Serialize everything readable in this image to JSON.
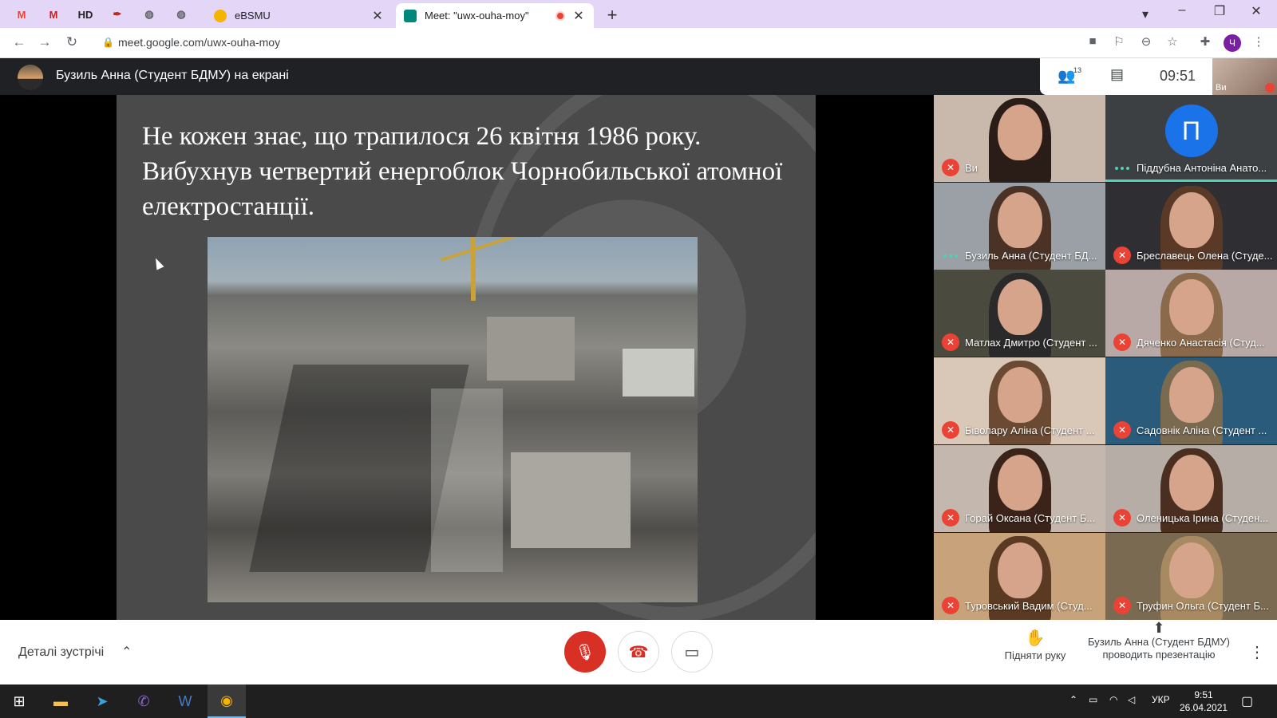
{
  "browser": {
    "pinned_tabs": [
      {
        "icon": "gmail-icon",
        "glyph": "M",
        "color": "#ea4335"
      },
      {
        "icon": "gmail-icon",
        "glyph": "M",
        "color": "#c5221f"
      },
      {
        "icon": "hd-icon",
        "glyph": "HD",
        "color": "#202124"
      },
      {
        "icon": "pen-icon",
        "glyph": "✒",
        "color": "#b3261e"
      },
      {
        "icon": "globe-icon",
        "glyph": "◍",
        "color": "#5f6368"
      },
      {
        "icon": "globe-icon",
        "glyph": "◍",
        "color": "#5f6368"
      }
    ],
    "tabs": [
      {
        "title": "eBSMU",
        "favicon_color": "#f4b400",
        "active": false
      },
      {
        "title": "Meet: \"uwx-ouha-moy\"",
        "favicon_color": "#00897b",
        "active": true,
        "recording_color": "#ea4335"
      }
    ],
    "new_tab_glyph": "+",
    "url": "meet.google.com/uwx-ouha-moy",
    "profile_initial": "Ч"
  },
  "meet": {
    "presenter_banner": "Бузиль Анна (Студент БДМУ) на екрані",
    "participant_count": "13",
    "clock": "09:51",
    "self_label": "Ви",
    "slide": {
      "text": "Не кожен знає, що трапилося 26 квітня 1986 року. Вибухнув четвертий енергоблок Чорнобильської атомної електростанції."
    },
    "participants": [
      {
        "name": "Ви",
        "muted": true,
        "kind": "video",
        "bg": "#c9b9ad",
        "hair": "#2a1d18"
      },
      {
        "name": "Піддубна Антоніна Анато...",
        "muted": false,
        "kind": "avatar",
        "letter": "П",
        "bg": "#3c4043"
      },
      {
        "name": "Бузиль Анна (Студент БД...",
        "muted": false,
        "kind": "video",
        "bg": "#9aa0a6",
        "hair": "#4a3326"
      },
      {
        "name": "Бреславець Олена (Студе...",
        "muted": true,
        "kind": "video",
        "bg": "#2f2f33",
        "hair": "#5a3a26"
      },
      {
        "name": "Матлах Дмитро (Студент ...",
        "muted": true,
        "kind": "video",
        "bg": "#4b4a3e",
        "hair": "#2a2a2a"
      },
      {
        "name": "Дяченко Анастасія (Студ...",
        "muted": true,
        "kind": "video",
        "bg": "#b9a9a6",
        "hair": "#8a6a4a"
      },
      {
        "name": "Біволару Аліна (Студент ...",
        "muted": true,
        "kind": "video",
        "bg": "#d9c7b8",
        "hair": "#6a4a32"
      },
      {
        "name": "Садовнік Аліна (Студент ...",
        "muted": true,
        "kind": "video",
        "bg": "#2b5b7a",
        "hair": "#7a6a50"
      },
      {
        "name": "Горай Оксана (Студент Б...",
        "muted": true,
        "kind": "video",
        "bg": "#c4b8ae",
        "hair": "#3a241a"
      },
      {
        "name": "Оленицька Ірина (Студен...",
        "muted": true,
        "kind": "video",
        "bg": "#b6ada6",
        "hair": "#4a2e20"
      },
      {
        "name": "Туровський Вадим (Студ...",
        "muted": true,
        "kind": "video",
        "bg": "#c7a27a",
        "hair": "#5a3a22"
      },
      {
        "name": "Труфин Ольга (Студент Б...",
        "muted": true,
        "kind": "video",
        "bg": "#7a6a52",
        "hair": "#a88a62"
      }
    ]
  },
  "controls": {
    "details_label": "Деталі зустрічі",
    "raise_hand_label": "Підняти руку",
    "presenting_label": "Бузиль Анна (Студент БДМУ) проводить презентацію"
  },
  "taskbar": {
    "language": "УКР",
    "time": "9:51",
    "date": "26.04.2021"
  },
  "colors": {
    "accent_meet": "#d93025",
    "speaking": "#4fd1b4",
    "tabstrip": "#e3d6f7"
  }
}
